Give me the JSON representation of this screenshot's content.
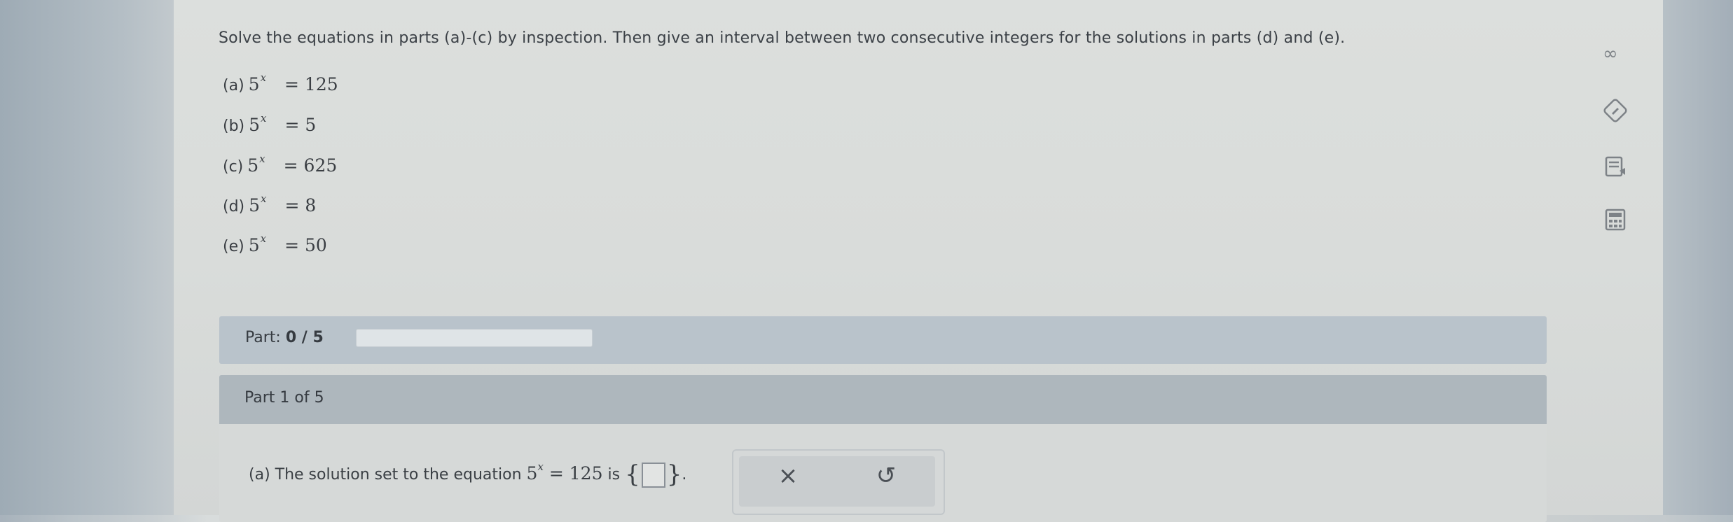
{
  "question": "Solve the equations in parts (a)-(c) by inspection. Then give an interval between two consecutive integers for the solutions in parts (d) and (e).",
  "equations": [
    {
      "label": "(a)",
      "base": "5",
      "exp": "x",
      "rhs": "= 125"
    },
    {
      "label": "(b)",
      "base": "5",
      "exp": "x",
      "rhs": "= 5"
    },
    {
      "label": "(c)",
      "base": "5",
      "exp": "x",
      "rhs": "= 625"
    },
    {
      "label": "(d)",
      "base": "5",
      "exp": "x",
      "rhs": "= 8"
    },
    {
      "label": "(e)",
      "base": "5",
      "exp": "x",
      "rhs": "= 50"
    }
  ],
  "progress": {
    "label": "Part:",
    "value_text": "0 / 5",
    "fraction": 0
  },
  "part_header": "Part 1 of 5",
  "answer": {
    "prefix": "(a) The solution set to the equation",
    "base": "5",
    "exp": "x",
    "rhs": "= 125",
    "suffix": "is",
    "end": "."
  },
  "buttons": {
    "clear": "×",
    "undo": "↺"
  },
  "icons": [
    "infinity-icon",
    "pencil-icon",
    "notes-icon",
    "calculator-icon"
  ],
  "colors": {
    "part_bar": "#b9c3cb",
    "card_header": "#aeb7bd"
  }
}
